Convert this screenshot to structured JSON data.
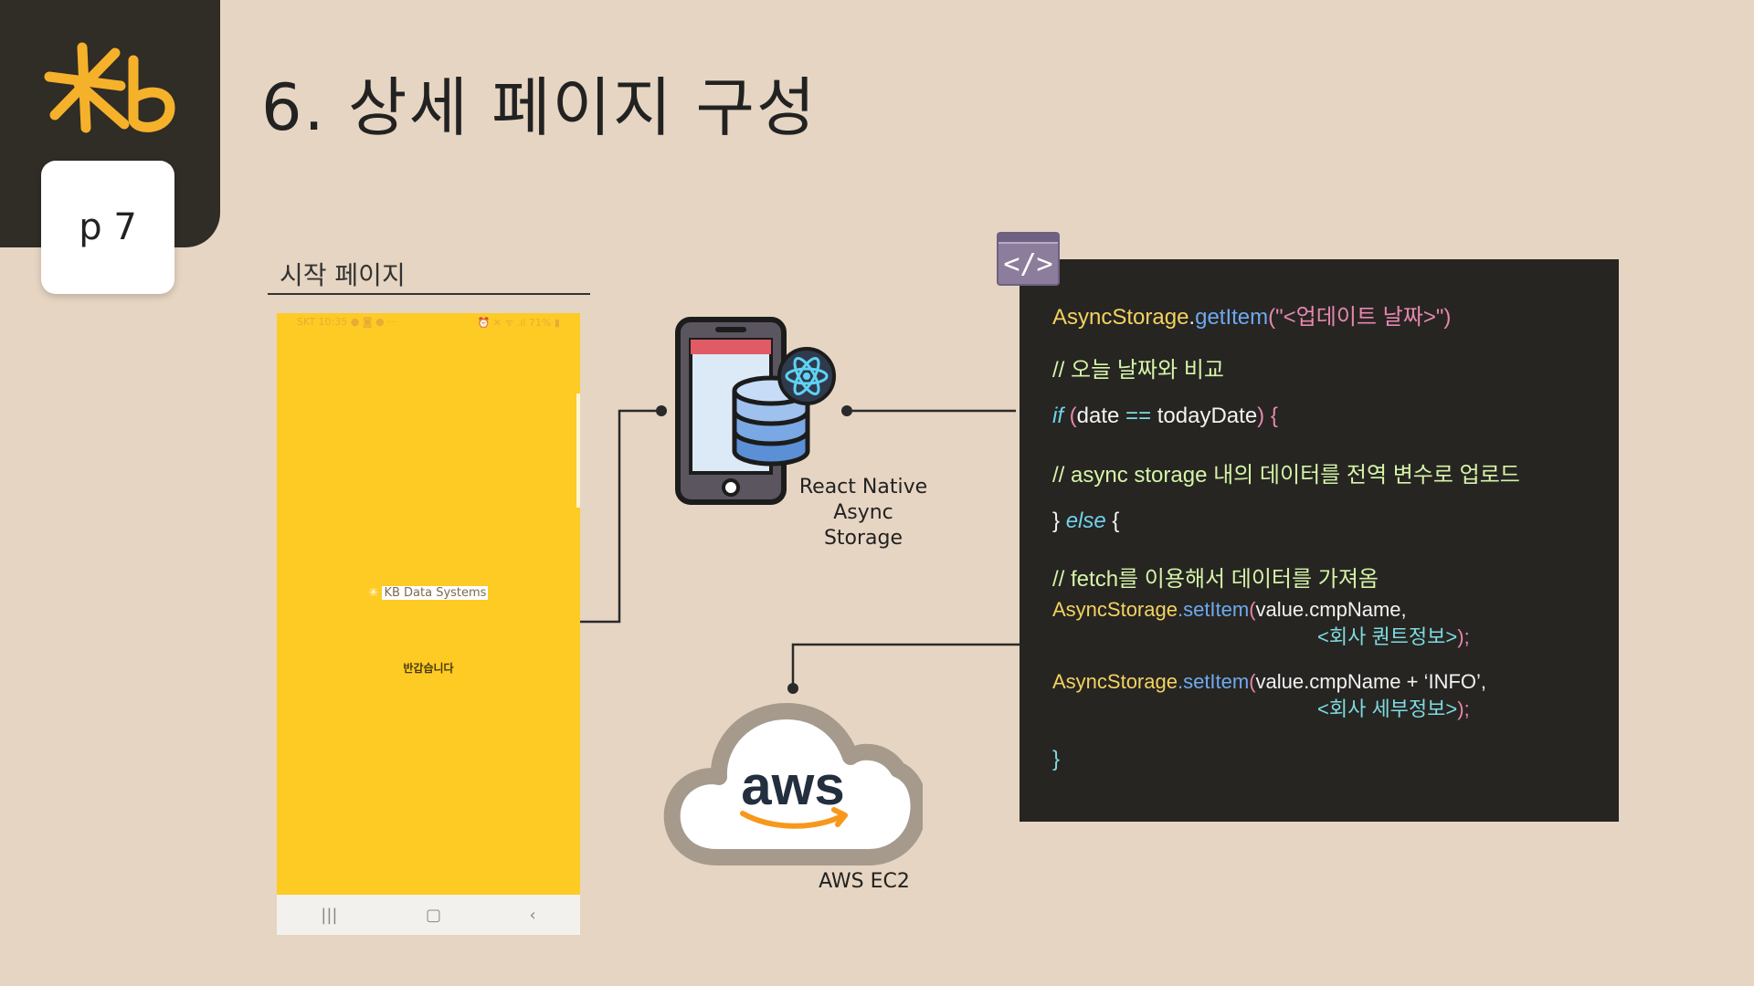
{
  "header": {
    "page_number": "p 7",
    "title": "6. 상세 페이지 구성"
  },
  "start_page": {
    "label": "시작 페이지",
    "status_left": "SKT 10:35 ● ◙ ● ···",
    "status_right": "⏰ ✕ ᯤ .ıl 71% ▮",
    "splash_text": "KB Data Systems",
    "welcome_text": "반갑습니다",
    "nav_recent": "|||",
    "nav_home": "▢",
    "nav_back": "‹"
  },
  "nodes": {
    "async_storage_label_line1": "React Native Async",
    "async_storage_label_line2": "Storage",
    "aws_label": "AWS EC2"
  },
  "code": {
    "icon_symbol": "</>",
    "l1_obj": "AsyncStorage",
    "l1_dot": ".",
    "l1_fn": "getItem",
    "l1_arg": "(\"<업데이트 날짜>\")",
    "l2": "// 오늘 날짜와 비교",
    "l3_kw": "if",
    "l3_open": " (",
    "l3_var": "date",
    "l3_op": " == ",
    "l3_var2": "todayDate",
    "l3_close": ") {",
    "l4": "// async storage 내의 데이터를 전역 변수로 업로드",
    "l5_close": "} ",
    "l5_kw": "else",
    "l5_open": " {",
    "l6": "// fetch를 이용해서 데이터를 가져옴",
    "l7_obj": "AsyncStorage",
    "l7_fn": ".setItem",
    "l7_open": "(",
    "l7_arg": "value.cmpName,",
    "l8": "<회사 퀀트정보>",
    "l8_end": ");",
    "l9_obj": "AsyncStorage",
    "l9_fn": ".setItem",
    "l9_open": "(",
    "l9_arg": "value.cmpName + ‘INFO’,",
    "l10": "<회사 세부정보>",
    "l10_end": ");",
    "l11": "}"
  },
  "colors": {
    "background": "#e6d5c2",
    "corner": "#302c26",
    "brand_yellow": "#f6b12b",
    "phone_yellow": "#fdcb23",
    "code_bg": "#262522"
  }
}
